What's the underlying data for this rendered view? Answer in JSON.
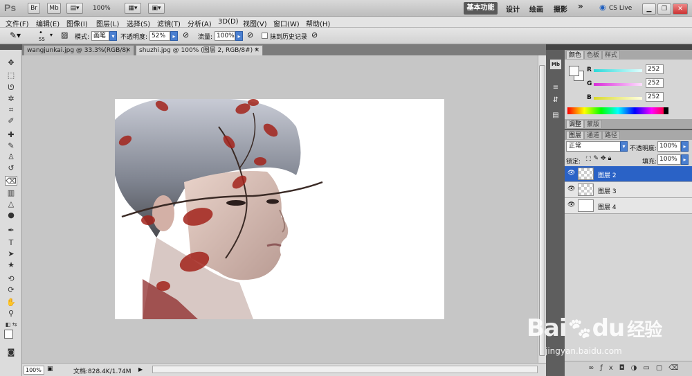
{
  "app": {
    "logo": "Ps",
    "title_buttons": [
      "Br",
      "Mb"
    ],
    "zoom": "100%",
    "workspaces": [
      "基本功能",
      "设计",
      "绘画",
      "摄影"
    ],
    "more": "»",
    "cs_live": "CS Live"
  },
  "menu": [
    "文件(F)",
    "编辑(E)",
    "图像(I)",
    "图层(L)",
    "选择(S)",
    "滤镜(T)",
    "分析(A)",
    "3D(D)",
    "视图(V)",
    "窗口(W)",
    "帮助(H)"
  ],
  "options": {
    "brush_size": "55",
    "mode_label": "模式:",
    "mode_value": "画笔",
    "opacity_label": "不透明度:",
    "opacity_value": "52%",
    "flow_label": "流量:",
    "flow_value": "100%",
    "erase_history_label": "抹到历史记录"
  },
  "tabs": [
    {
      "label": "wangjunkai.jpg @ 33.3%(RGB/8)",
      "close": "✕"
    },
    {
      "label": "shuzhi.jpg @ 100% (图层 2, RGB/8#) *",
      "close": "✕"
    }
  ],
  "status": {
    "zoom": "100%",
    "doc": "文档:828.4K/1.74M"
  },
  "color_panel": {
    "tabs": [
      "颜色",
      "色板",
      "样式"
    ],
    "channels": [
      {
        "name": "R",
        "value": "252",
        "color": "#22d4d4"
      },
      {
        "name": "G",
        "value": "252",
        "color": "#d422d4"
      },
      {
        "name": "B",
        "value": "252",
        "color": "#d4d422"
      }
    ]
  },
  "adjust_panel": {
    "tabs": [
      "调整",
      "蒙版"
    ]
  },
  "layers_panel": {
    "tabs": [
      "图层",
      "通道",
      "路径"
    ],
    "blend_mode": "正常",
    "opacity_label": "不透明度:",
    "opacity_value": "100%",
    "lock_label": "锁定:",
    "fill_label": "填充:",
    "fill_value": "100%",
    "layers": [
      {
        "name": "图层 2",
        "selected": true
      },
      {
        "name": "图层 3",
        "selected": false
      },
      {
        "name": "图层 4",
        "selected": false
      }
    ]
  },
  "watermark": {
    "brand": "Bai",
    "brand2": "du",
    "cn": "经验",
    "url": "jingyan.baidu.com"
  }
}
